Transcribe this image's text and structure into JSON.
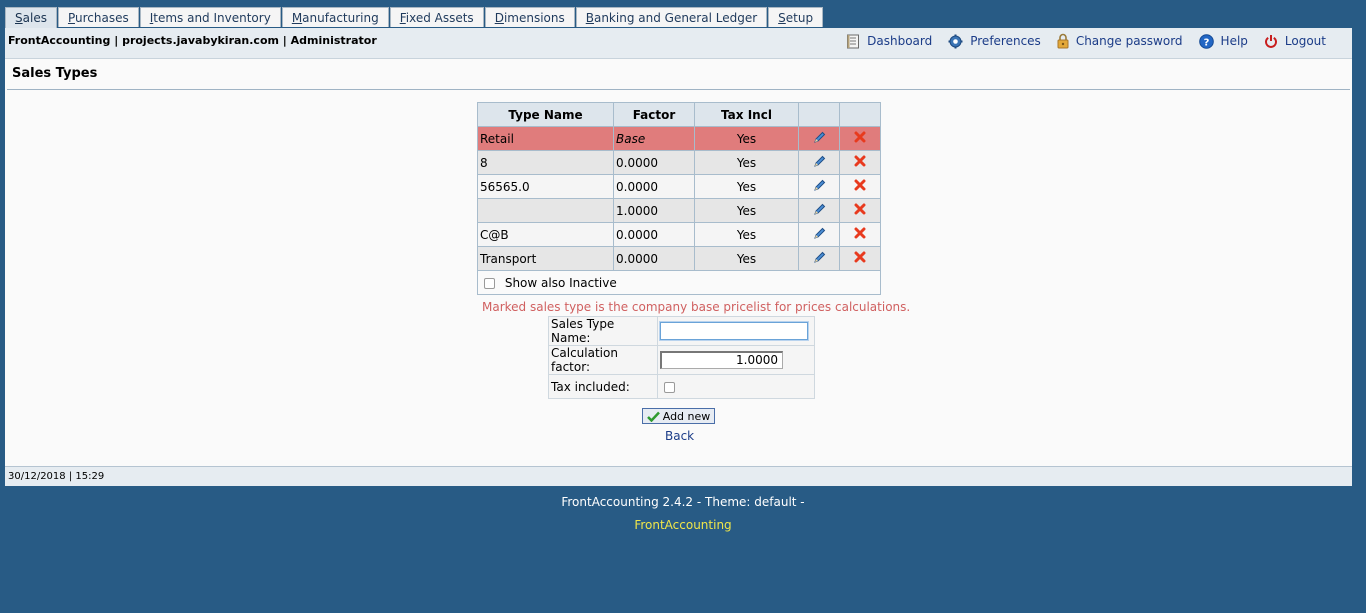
{
  "tabs": [
    {
      "u": "S",
      "rest": "ales",
      "active": true
    },
    {
      "u": "P",
      "rest": "urchases"
    },
    {
      "u": "I",
      "rest": "tems and Inventory"
    },
    {
      "u": "M",
      "rest": "anufacturing"
    },
    {
      "u": "F",
      "rest": "ixed Assets"
    },
    {
      "u": "D",
      "rest": "imensions"
    },
    {
      "u": "B",
      "rest": "anking and General Ledger"
    },
    {
      "u": "S",
      "rest": "etup"
    }
  ],
  "header": {
    "company": "FrontAccounting | projects.javabykiran.com | Administrator",
    "links": {
      "dashboard": "Dashboard",
      "preferences": "Preferences",
      "change_password": "Change password",
      "help": "Help",
      "logout": "Logout"
    }
  },
  "page": {
    "title": "Sales Types"
  },
  "table": {
    "headers": [
      "Type Name",
      "Factor",
      "Tax Incl",
      "",
      ""
    ],
    "rows": [
      {
        "name": "Retail",
        "factor": "Base",
        "tax": "Yes"
      },
      {
        "name": "8",
        "factor": "0.0000",
        "tax": "Yes"
      },
      {
        "name": "56565.0",
        "factor": "0.0000",
        "tax": "Yes"
      },
      {
        "name": "",
        "factor": "1.0000",
        "tax": "Yes"
      },
      {
        "name": "C@B",
        "factor": "0.0000",
        "tax": "Yes"
      },
      {
        "name": "Transport",
        "factor": "0.0000",
        "tax": "Yes"
      }
    ],
    "show_inactive_label": "Show also Inactive"
  },
  "note": "Marked sales type is the company base pricelist for prices calculations.",
  "form": {
    "name_label": "Sales Type Name:",
    "name_value": "",
    "factor_label": "Calculation factor:",
    "factor_value": "1.0000",
    "tax_label": "Tax included:"
  },
  "buttons": {
    "add_new": "Add new",
    "back": "Back"
  },
  "status": {
    "datetime": "30/12/2018 | 15:29"
  },
  "footer": {
    "version": "FrontAccounting 2.4.2 - Theme: default -",
    "link": "FrontAccounting"
  },
  "colors": {
    "background": "#285b85",
    "base_row": "#e07c7c",
    "note": "#d06060",
    "footer_link": "#f0e64a"
  }
}
